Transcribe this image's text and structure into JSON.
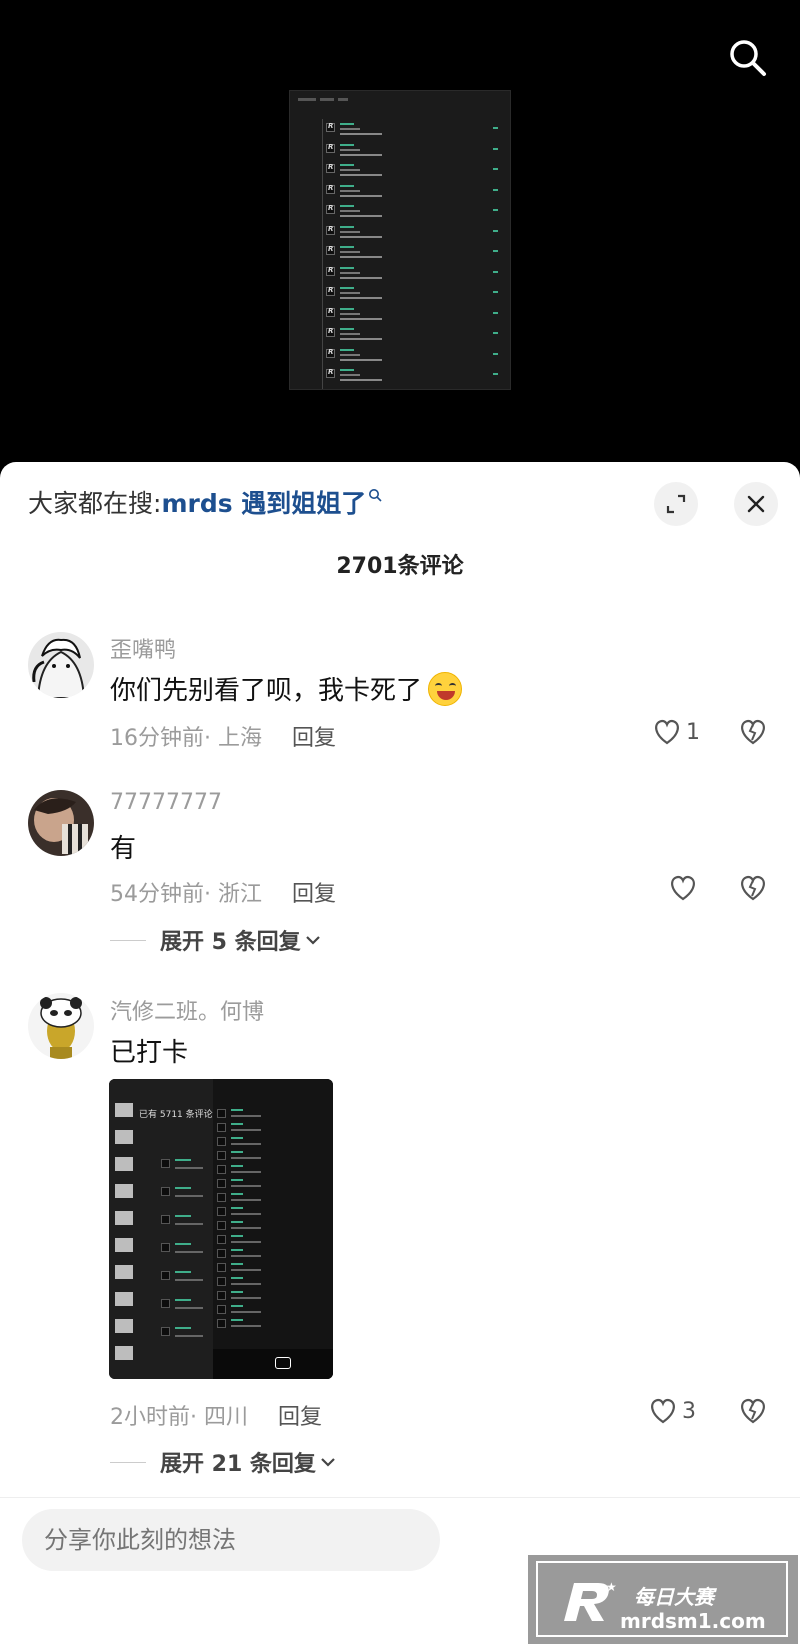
{
  "header": {
    "search_icon": "search-icon"
  },
  "sheet": {
    "hot_search_prefix": "大家都在搜:",
    "hot_search_keyword": "mrds 遇到姐姐了",
    "expand_icon": "fullscreen-icon",
    "close_icon": "close-icon",
    "comment_count": "2701条评论"
  },
  "comments": [
    {
      "username": "歪嘴鸭",
      "text": "你们先别看了呗，我卡死了",
      "emoji": "grinning-emoji",
      "time": "16分钟前",
      "location": "· 上海",
      "reply_label": "回复",
      "likes": "1"
    },
    {
      "username": "77777777",
      "text": "有",
      "time": "54分钟前",
      "location": "· 浙江",
      "reply_label": "回复",
      "likes": "",
      "expand_label": "展开 5 条回复"
    },
    {
      "username": "汽修二班。何博",
      "text": "已打卡",
      "time": "2小时前",
      "location": "· 四川",
      "reply_label": "回复",
      "likes": "3",
      "expand_label": "展开 21 条回复",
      "attachment": {
        "headline": "已有 5711 条评论"
      }
    }
  ],
  "input": {
    "placeholder": "分享你此刻的想法"
  },
  "watermark": {
    "cn": "每日大赛",
    "url": "mrdsm1.com"
  },
  "colors": {
    "keyword": "#1d4f8f",
    "accent_green": "#3fae8a"
  }
}
